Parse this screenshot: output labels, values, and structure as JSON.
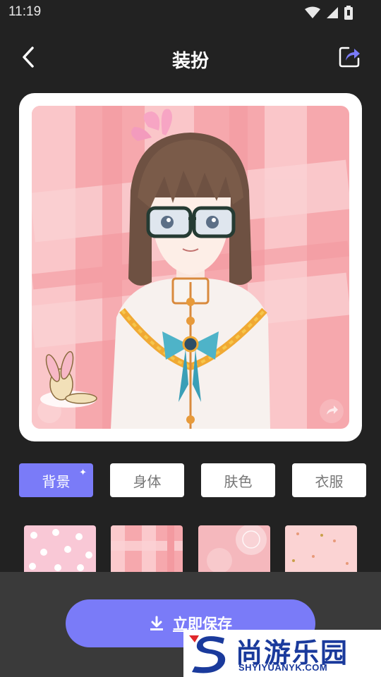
{
  "status_bar": {
    "time": "11:19"
  },
  "header": {
    "title": "装扮"
  },
  "tabs": [
    {
      "label": "背景",
      "active": true
    },
    {
      "label": "身体",
      "active": false
    },
    {
      "label": "肤色",
      "active": false
    },
    {
      "label": "衣服",
      "active": false
    }
  ],
  "thumbnails": [
    {
      "name": "bunny-pattern"
    },
    {
      "name": "pink-plaid"
    },
    {
      "name": "pink-lace"
    },
    {
      "name": "heart-dots"
    }
  ],
  "save_button": {
    "label": "立即保存"
  },
  "watermark": {
    "name": "尚游乐园",
    "domain": "SHYIYUANYK.COM"
  },
  "colors": {
    "accent": "#7a7bf8",
    "background": "#222222",
    "panel": "#3a3a3a",
    "plaid": "#f6a7ab"
  }
}
